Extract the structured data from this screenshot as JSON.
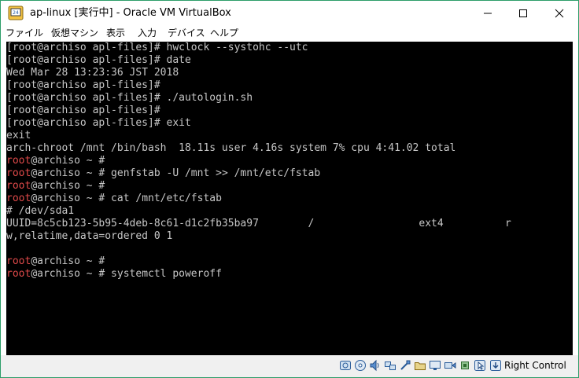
{
  "window": {
    "title": "ap-linux [実行中] - Oracle VM VirtualBox",
    "minimize": "—",
    "maximize": "☐",
    "close": "✕"
  },
  "menu": [
    "ファイル",
    "仮想マシン",
    "表示",
    "入力",
    "デバイス",
    "ヘルプ"
  ],
  "terminal": {
    "lines": [
      {
        "text": "[root@archiso apl-files]# hwclock --systohc --utc"
      },
      {
        "text": "[root@archiso apl-files]# date"
      },
      {
        "text": "Wed Mar 28 13:23:36 JST 2018"
      },
      {
        "text": "[root@archiso apl-files]#"
      },
      {
        "text": "[root@archiso apl-files]# ./autologin.sh"
      },
      {
        "text": "[root@archiso apl-files]#"
      },
      {
        "text": "[root@archiso apl-files]# exit"
      },
      {
        "text": "exit"
      },
      {
        "text": "arch-chroot /mnt /bin/bash  18.11s user 4.16s system 7% cpu 4:41.02 total"
      },
      {
        "red": "root",
        "text": "@archiso ~ #"
      },
      {
        "red": "root",
        "text": "@archiso ~ # genfstab -U /mnt >> /mnt/etc/fstab"
      },
      {
        "red": "root",
        "text": "@archiso ~ #"
      },
      {
        "red": "root",
        "text": "@archiso ~ # cat /mnt/etc/fstab"
      },
      {
        "text": "# /dev/sda1"
      },
      {
        "text": "UUID=8c5cb123-5b95-4deb-8c61-d1c2fb35ba97        /                 ext4          r"
      },
      {
        "text": "w,relatime,data=ordered 0 1"
      },
      {
        "text": ""
      },
      {
        "red": "root",
        "text": "@archiso ~ #"
      },
      {
        "red": "root",
        "text": "@archiso ~ # systemctl poweroff"
      }
    ]
  },
  "status": {
    "host_key": "Right Control",
    "icons": [
      "hard-disk-icon",
      "optical-drive-icon",
      "audio-icon",
      "network-icon",
      "usb-icon",
      "shared-folder-icon",
      "display-icon",
      "video-capture-icon",
      "cpu-icon",
      "mouse-integration-icon",
      "host-key-arrow-icon"
    ]
  },
  "colors": {
    "console_bg": "#000000",
    "console_fg": "#c6c6c6",
    "prompt_root": "#e04a4a",
    "window_border": "#2e9e6a"
  }
}
